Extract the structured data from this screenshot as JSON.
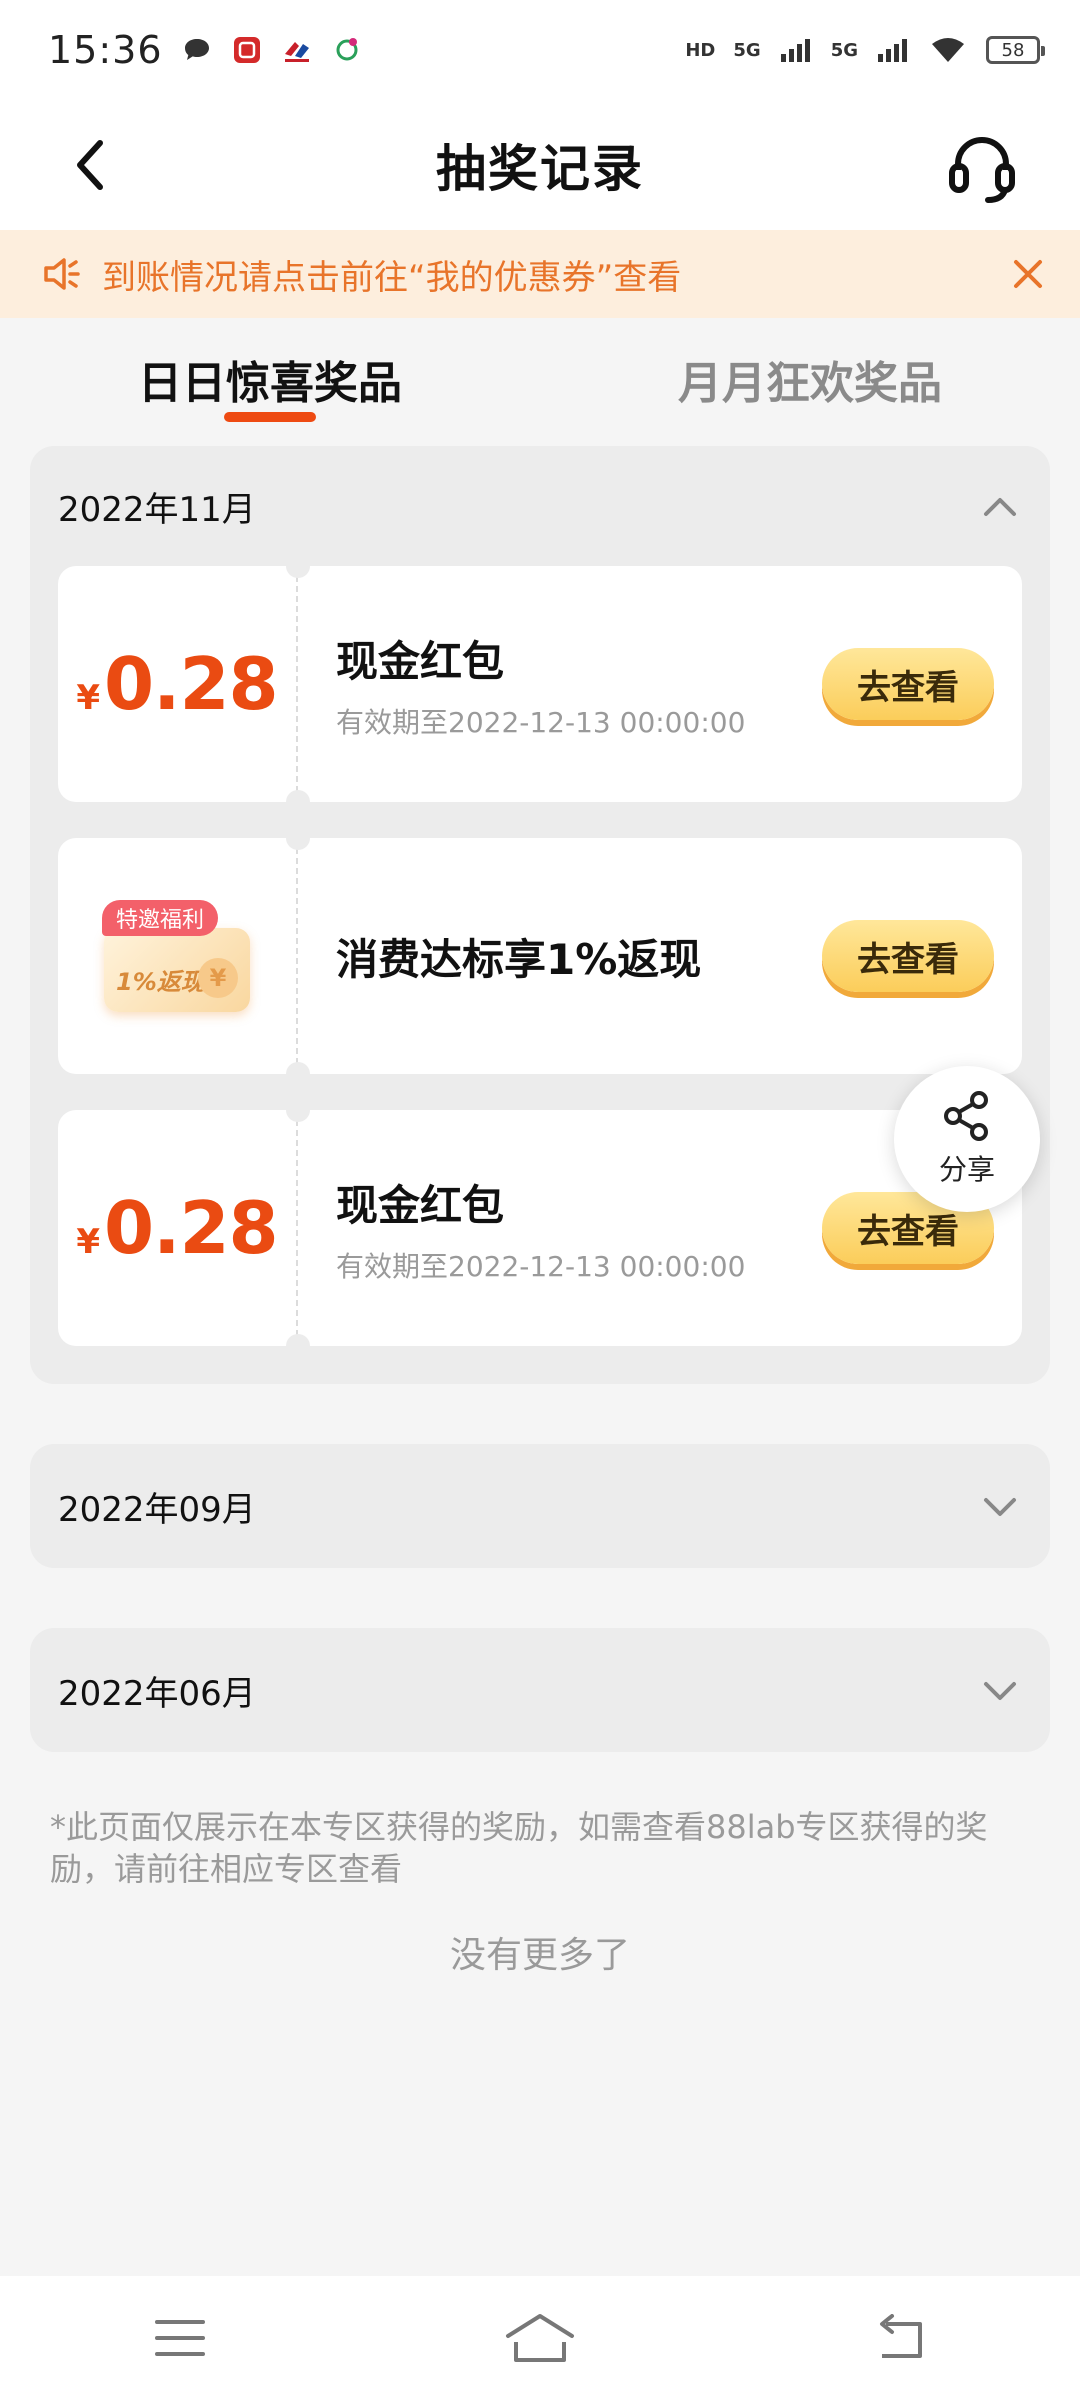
{
  "status_bar": {
    "time": "15:36",
    "network_1": "5G",
    "network_2": "5G",
    "hd": "HD",
    "battery": "58"
  },
  "header": {
    "title": "抽奖记录"
  },
  "notice": {
    "text": "到账情况请点击前往“我的优惠券”查看"
  },
  "tabs": [
    {
      "label": "日日惊喜奖品",
      "active": true
    },
    {
      "label": "月月狂欢奖品",
      "active": false
    }
  ],
  "months": [
    {
      "label": "2022年11月",
      "expanded": true,
      "items": [
        {
          "type": "cash",
          "currency": "¥",
          "amount": "0.28",
          "name": "现金红包",
          "expiry": "有效期至2022-12-13 00:00:00",
          "button": "去查看"
        },
        {
          "type": "coupon",
          "tag": "特邀福利",
          "coupon_text": "1%返现",
          "coin": "¥",
          "name": "消费达标享1%返现",
          "button": "去查看"
        },
        {
          "type": "cash",
          "currency": "¥",
          "amount": "0.28",
          "name": "现金红包",
          "expiry": "有效期至2022-12-13 00:00:00",
          "button": "去查看"
        }
      ]
    },
    {
      "label": "2022年09月",
      "expanded": false
    },
    {
      "label": "2022年06月",
      "expanded": false
    }
  ],
  "share": {
    "label": "分享"
  },
  "footnote": "*此页面仅展示在本专区获得的奖励，如需查看88lab专区获得的奖励，请前往相应专区查看",
  "no_more": "没有更多了",
  "colors": {
    "accent": "#ea4b12",
    "notice_bg": "#fdeedd",
    "notice_text": "#e8742a",
    "button_bg": "#fbcd5a"
  }
}
